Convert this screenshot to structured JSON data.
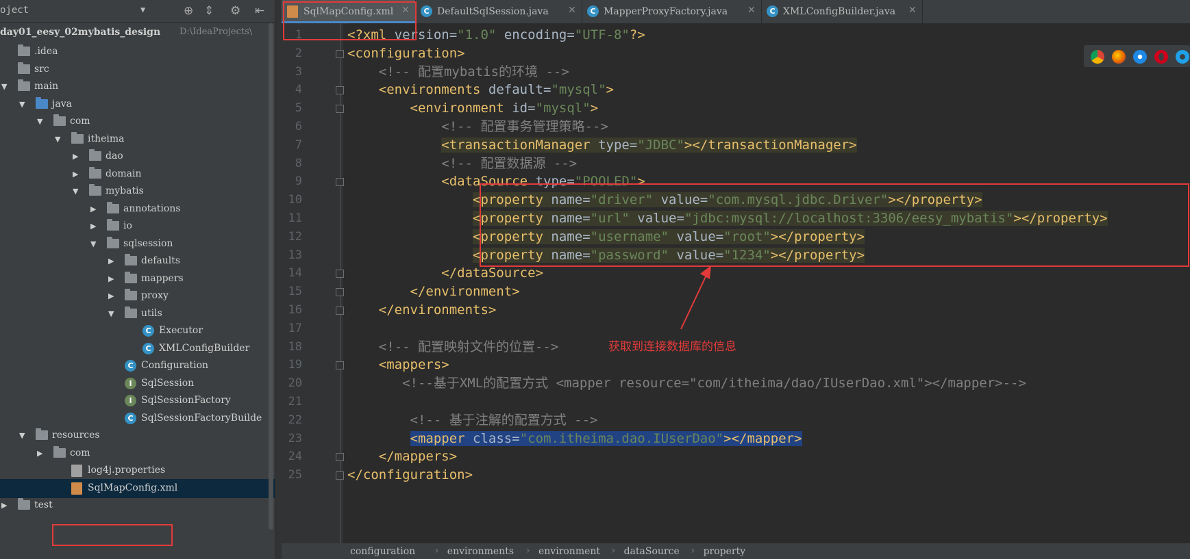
{
  "project_panel": {
    "title": "oject",
    "dropdown": "▼",
    "toolbar_icons": [
      "target-icon",
      "collapse-icon",
      "gear-icon",
      "hide-icon"
    ],
    "root_name": "day01_eesy_02mybatis_design",
    "root_path": "D:\\IdeaProjects\\"
  },
  "tree": [
    {
      "label": ".idea",
      "icon": "folder",
      "indent": 0,
      "arrow": ""
    },
    {
      "label": "src",
      "icon": "folder",
      "indent": 0,
      "arrow": ""
    },
    {
      "label": "main",
      "icon": "folder",
      "indent": 0,
      "arrow": "▼"
    },
    {
      "label": "java",
      "icon": "folder-blue",
      "indent": 1,
      "arrow": "▼"
    },
    {
      "label": "com",
      "icon": "folder",
      "indent": 2,
      "arrow": "▼"
    },
    {
      "label": "itheima",
      "icon": "folder",
      "indent": 3,
      "arrow": "▼"
    },
    {
      "label": "dao",
      "icon": "folder",
      "indent": 4,
      "arrow": "▶"
    },
    {
      "label": "domain",
      "icon": "folder",
      "indent": 4,
      "arrow": "▶"
    },
    {
      "label": "mybatis",
      "icon": "folder",
      "indent": 4,
      "arrow": "▼"
    },
    {
      "label": "annotations",
      "icon": "folder",
      "indent": 5,
      "arrow": "▶"
    },
    {
      "label": "io",
      "icon": "folder",
      "indent": 5,
      "arrow": "▶"
    },
    {
      "label": "sqlsession",
      "icon": "folder",
      "indent": 5,
      "arrow": "▼"
    },
    {
      "label": "defaults",
      "icon": "folder",
      "indent": 6,
      "arrow": "▶"
    },
    {
      "label": "mappers",
      "icon": "folder",
      "indent": 6,
      "arrow": "▶"
    },
    {
      "label": "proxy",
      "icon": "folder",
      "indent": 6,
      "arrow": "▶"
    },
    {
      "label": "utils",
      "icon": "folder",
      "indent": 6,
      "arrow": "▼"
    },
    {
      "label": "Executor",
      "icon": "class",
      "indent": 7,
      "arrow": ""
    },
    {
      "label": "XMLConfigBuilder",
      "icon": "class",
      "indent": 7,
      "arrow": ""
    },
    {
      "label": "Configuration",
      "icon": "class",
      "indent": 6,
      "arrow": ""
    },
    {
      "label": "SqlSession",
      "icon": "interface",
      "indent": 6,
      "arrow": ""
    },
    {
      "label": "SqlSessionFactory",
      "icon": "interface",
      "indent": 6,
      "arrow": ""
    },
    {
      "label": "SqlSessionFactoryBuilde",
      "icon": "class",
      "indent": 6,
      "arrow": ""
    },
    {
      "label": "resources",
      "icon": "folder-res",
      "indent": 1,
      "arrow": "▼"
    },
    {
      "label": "com",
      "icon": "folder",
      "indent": 2,
      "arrow": "▶"
    },
    {
      "label": "log4j.properties",
      "icon": "props",
      "indent": 3,
      "arrow": ""
    },
    {
      "label": "SqlMapConfig.xml",
      "icon": "xml",
      "indent": 3,
      "arrow": "",
      "selected": true
    },
    {
      "label": "test",
      "icon": "folder",
      "indent": 0,
      "arrow": "▶"
    }
  ],
  "tabs": [
    {
      "label": "SqlMapConfig.xml",
      "active": true,
      "icon": "xml"
    },
    {
      "label": "DefaultSqlSession.java",
      "active": false,
      "icon": "class"
    },
    {
      "label": "MapperProxyFactory.java",
      "active": false,
      "icon": "class"
    },
    {
      "label": "XMLConfigBuilder.java",
      "active": false,
      "icon": "class"
    }
  ],
  "tab_close": "✕",
  "code_lines": [
    "<?xml version=\"1.0\" encoding=\"UTF-8\"?>",
    "<configuration>",
    "    <!-- 配置mybatis的环境 -->",
    "    <environments default=\"mysql\">",
    "        <environment id=\"mysql\">",
    "            <!-- 配置事务管理策略-->",
    "            <transactionManager type=\"JDBC\"></transactionManager>",
    "            <!-- 配置数据源 -->",
    "            <dataSource type=\"POOLED\">",
    "                <property name=\"driver\" value=\"com.mysql.jdbc.Driver\"></property>",
    "                <property name=\"url\" value=\"jdbc:mysql://localhost:3306/eesy_mybatis\"></property>",
    "                <property name=\"username\" value=\"root\"></property>",
    "                <property name=\"password\" value=\"1234\"></property>",
    "            </dataSource>",
    "        </environment>",
    "    </environments>",
    "",
    "    <!-- 配置映射文件的位置-->",
    "    <mappers>",
    "       <!--基于XML的配置方式 <mapper resource=\"com/itheima/dao/IUserDao.xml\"></mapper>-->",
    "",
    "        <!-- 基于注解的配置方式 -->",
    "        <mapper class=\"com.itheima.dao.IUserDao\"></mapper>",
    "    </mappers>",
    "</configuration>"
  ],
  "annotation_text": "获取到连接数据库的信息",
  "breadcrumbs": [
    "configuration",
    "environments",
    "environment",
    "dataSource",
    "property"
  ],
  "browser_icons": [
    "chrome-icon",
    "firefox-icon",
    "safari-icon",
    "opera-icon",
    "ie-icon"
  ],
  "colors": {
    "tag": "#e8bf6a",
    "attr": "#bababa",
    "string": "#6a8759",
    "comment": "#808080",
    "callout": "#e23a3a",
    "selection": "#214283"
  }
}
